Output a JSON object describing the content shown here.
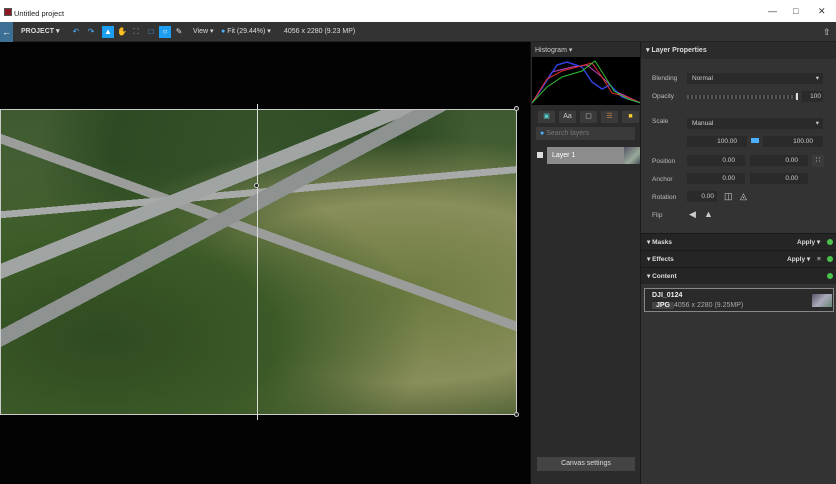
{
  "window": {
    "title": "Untitled project"
  },
  "toolbar": {
    "project_label": "PROJECT",
    "view_label": "View",
    "zoom_label": "Fit (29.44%)",
    "dimensions": "4056 x 2280 (9.23 MP)"
  },
  "histogram": {
    "label": "Histogram"
  },
  "layers": {
    "search_placeholder": "Search layers",
    "items": [
      {
        "name": "Layer 1"
      }
    ],
    "canvas_settings": "Canvas settings"
  },
  "properties": {
    "title": "Layer Properties",
    "blending_label": "Blending",
    "blending_value": "Normal",
    "opacity_label": "Opacity",
    "opacity_value": "100",
    "opacity_fraction": 1.0,
    "scale_label": "Scale",
    "scale_mode": "Manual",
    "scale_w": "100.00",
    "scale_h": "100.00",
    "position_label": "Position",
    "position_x": "0.00",
    "position_y": "0.00",
    "anchor_label": "Anchor",
    "anchor_x": "0.00",
    "anchor_y": "0.00",
    "rotation_label": "Rotation",
    "rotation_value": "0.00",
    "flip_label": "Flip",
    "unit": "%"
  },
  "sections": {
    "masks": "Masks",
    "effects": "Effects",
    "content": "Content",
    "apply": "Apply"
  },
  "content": {
    "name": "DJI_0124",
    "type": "JPG",
    "info": "4056 x 2280 (9.25MP)"
  },
  "colors": {
    "accent": "#1e9ef0",
    "status": "#4cc24c"
  }
}
